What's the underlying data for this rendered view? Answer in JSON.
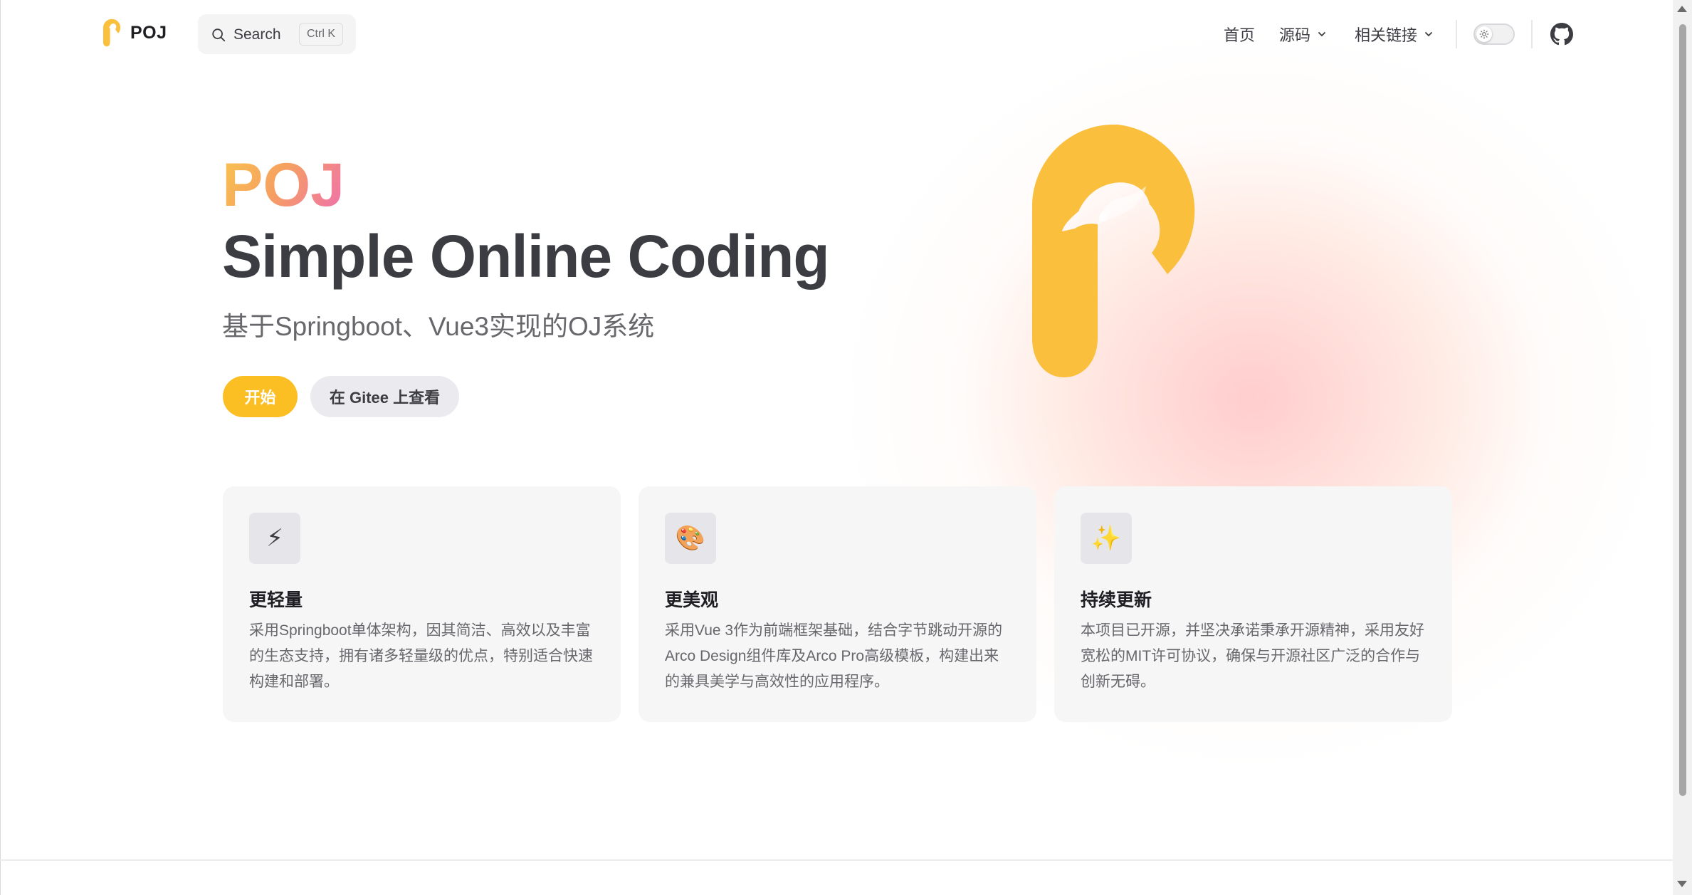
{
  "nav": {
    "brand": "POJ",
    "search": {
      "label": "Search",
      "shortcut": "Ctrl K"
    },
    "links": [
      {
        "label": "首页",
        "has_dropdown": false
      },
      {
        "label": "源码",
        "has_dropdown": true
      },
      {
        "label": "相关链接",
        "has_dropdown": true
      }
    ],
    "theme_toggle": {
      "icon": "sun-icon",
      "state": "light"
    },
    "social_icon": "github-icon"
  },
  "hero": {
    "name": "POJ",
    "text": "Simple Online Coding",
    "tagline": "基于Springboot、Vue3实现的OJ系统",
    "actions": [
      {
        "label": "开始",
        "variant": "brand"
      },
      {
        "label": "在 Gitee 上查看",
        "variant": "alt"
      }
    ],
    "logo_color": "#FBBF3E"
  },
  "features": [
    {
      "icon": "⚡",
      "icon_name": "lightning-icon",
      "title": "更轻量",
      "details": "采用Springboot单体架构，因其简洁、高效以及丰富的生态支持，拥有诸多轻量级的优点，特别适合快速构建和部署。"
    },
    {
      "icon": "🎨",
      "icon_name": "palette-icon",
      "title": "更美观",
      "details": "采用Vue 3作为前端框架基础，结合字节跳动开源的Arco Design组件库及Arco Pro高级模板，构建出来的兼具美学与高效性的应用程序。"
    },
    {
      "icon": "✨",
      "icon_name": "sparkles-icon",
      "title": "持续更新",
      "details": "本项目已开源，并坚决承诺秉承开源精神，采用友好宽松的MIT许可协议，确保与开源社区广泛的合作与创新无碍。"
    }
  ],
  "colors": {
    "brand": "#FBBF24",
    "text": "#3C3C43",
    "muted": "#67676C",
    "card_bg": "#F6F6F7"
  }
}
